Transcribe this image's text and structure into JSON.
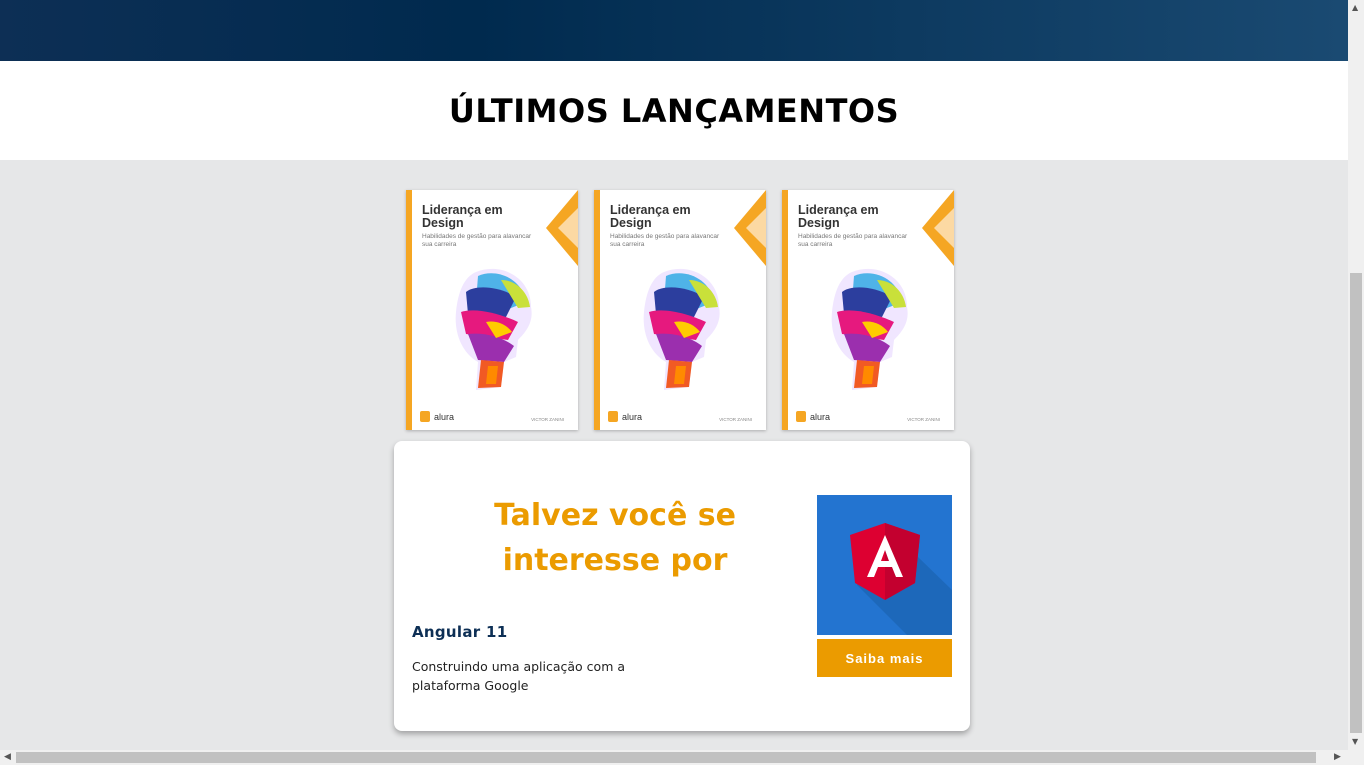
{
  "section": {
    "title": "ÚLTIMOS LANÇAMENTOS"
  },
  "books": [
    {
      "title": "Liderança em Design",
      "subtitle": "Habilidades de gestão para alavancar sua carreira",
      "publisher": "alura",
      "author": "VICTOR ZANINI"
    },
    {
      "title": "Liderança em Design",
      "subtitle": "Habilidades de gestão para alavancar sua carreira",
      "publisher": "alura",
      "author": "VICTOR ZANINI"
    },
    {
      "title": "Liderança em Design",
      "subtitle": "Habilidades de gestão para alavancar sua carreira",
      "publisher": "alura",
      "author": "VICTOR ZANINI"
    }
  ],
  "suggestion": {
    "heading": "Talvez você se interesse por",
    "course_name": "Angular 11",
    "course_desc": "Construindo uma aplicação com a plataforma Google",
    "thumb_icon": "angular-logo",
    "button_label": "Saiba mais"
  },
  "colors": {
    "header": "#002a4e",
    "accent": "#eb9b00",
    "thumb_bg": "#2374d0",
    "angular_red": "#dd0031",
    "book_spine": "#f5a623"
  }
}
